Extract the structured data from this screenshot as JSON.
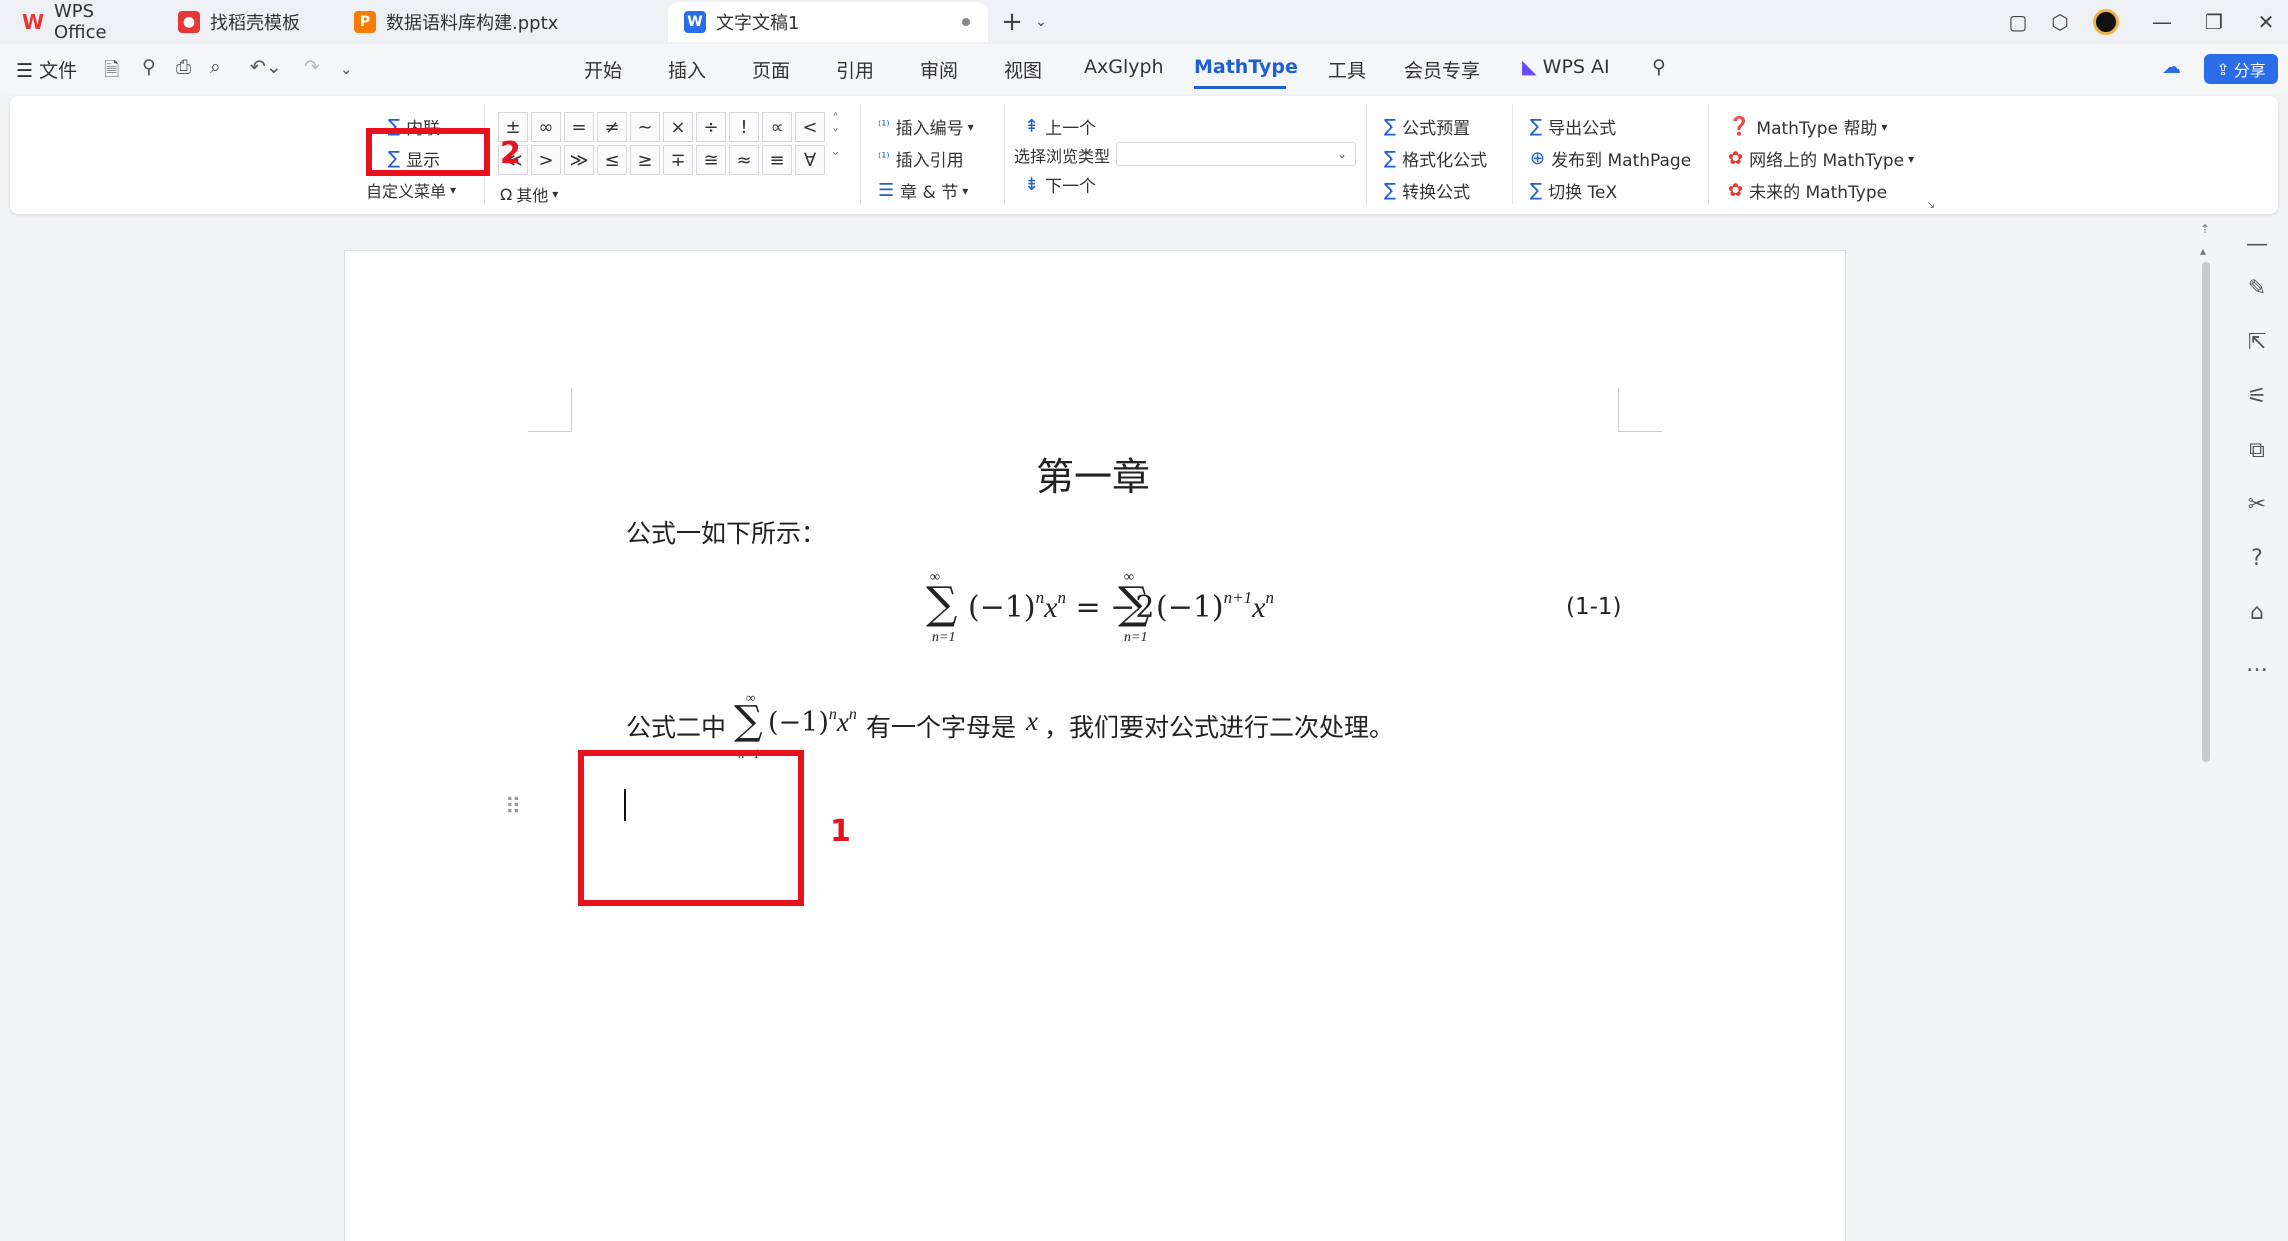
{
  "titlebar": {
    "tabs": [
      {
        "label": "WPS Office",
        "icon": "wps-logo-icon",
        "color": "#e53935"
      },
      {
        "label": "找稻壳模板",
        "icon": "docer-icon",
        "color": "#e53935"
      },
      {
        "label": "数据语料库构建.pptx",
        "icon": "ppt-icon",
        "color": "#f57c00"
      },
      {
        "label": "文字文稿1",
        "icon": "word-icon",
        "color": "#2b6de8"
      }
    ]
  },
  "menubar": {
    "file": "文件",
    "items": [
      "开始",
      "插入",
      "页面",
      "引用",
      "审阅",
      "视图",
      "AxGlyph",
      "MathType",
      "工具",
      "会员专享",
      "WPS AI"
    ],
    "active": "MathType",
    "share": "分享"
  },
  "ribbon": {
    "inline_label": "内联",
    "display_label": "显示",
    "custom_menu": "自定义菜单",
    "symbols_row1": [
      "±",
      "∞",
      "=",
      "≠",
      "~",
      "×",
      "÷",
      "!",
      "∝",
      "<"
    ],
    "symbols_row2": [
      "≪",
      ">",
      "≫",
      "≤",
      "≥",
      "∓",
      "≅",
      "≈",
      "≡",
      "∀"
    ],
    "other": "其他",
    "insert_number": "插入编号",
    "insert_ref": "插入引用",
    "chapter_section": "章 & 节",
    "prev": "上一个",
    "browse_type": "选择浏览类型",
    "next": "下一个",
    "formula_preset": "公式预置",
    "format_formula": "格式化公式",
    "convert_formula": "转换公式",
    "export_formula": "导出公式",
    "publish_mathpage": "发布到 MathPage",
    "toggle_tex": "切换 TeX",
    "mathtype_help": "MathType 帮助",
    "mathtype_web": "网络上的 MathType",
    "mathtype_future": "未来的 MathType"
  },
  "annotations": {
    "box1_label": "1",
    "box2_label": "2",
    "color": "#e8121c"
  },
  "document": {
    "chapter_title": "第一章",
    "para1": "公式一如下所示：",
    "eq_number": "(1-1)",
    "para2_pre": "公式二中",
    "para2_mid": "有一个字母是",
    "para2_var": "x",
    "para2_post": "，我们要对公式进行二次处理。"
  }
}
